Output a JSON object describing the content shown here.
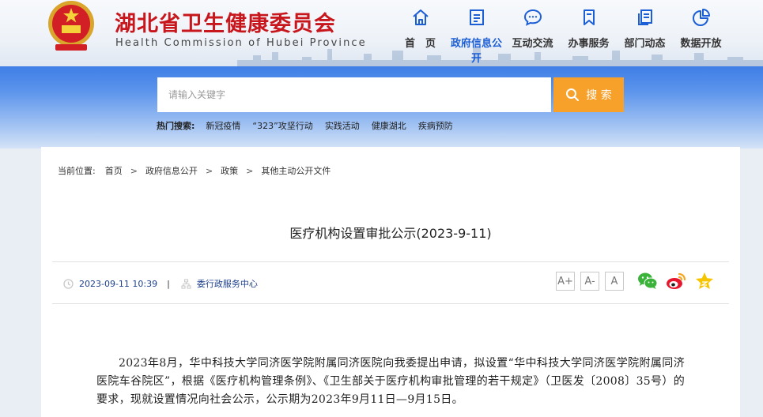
{
  "header": {
    "site_title": "湖北省卫生健康委员会",
    "site_subtitle": "Health Commission of Hubei Province",
    "nav": [
      {
        "label": "首　页",
        "icon": "home-icon"
      },
      {
        "label": "政府信息公开",
        "icon": "document-icon",
        "active": true
      },
      {
        "label": "互动交流",
        "icon": "chat-icon"
      },
      {
        "label": "办事服务",
        "icon": "bookmark-icon"
      },
      {
        "label": "部门动态",
        "icon": "copy-icon"
      },
      {
        "label": "数据开放",
        "icon": "pie-chart-icon"
      }
    ]
  },
  "search": {
    "placeholder": "请输入关键字",
    "button_label": "搜 索",
    "hot_label": "热门搜索:",
    "hot_items": [
      "新冠疫情",
      "“323”攻坚行动",
      "实践活动",
      "健康湖北",
      "疾病预防"
    ]
  },
  "breadcrumb": {
    "label": "当前位置:",
    "items": [
      "首页",
      "政府信息公开",
      "政策",
      "其他主动公开文件"
    ]
  },
  "article": {
    "title": "医疗机构设置审批公示(2023-9-11)",
    "date": "2023-09-11 10:39",
    "source": "委行政服务中心",
    "body": "2023年8月，华中科技大学同济医学院附属同济医院向我委提出申请，拟设置“华中科技大学同济医学院附属同济医院车谷院区”，根据《医疗机构管理条例》、《卫生部关于医疗机构审批管理的若干规定》（卫医发〔2008〕35号）的要求，现就设置情况向社会公示，公示期为2023年9月11日—9月15日。"
  },
  "tools": {
    "font_sizes": [
      "A+",
      "A-",
      "A"
    ],
    "share": [
      "wechat-icon",
      "weibo-icon",
      "favorite-icon"
    ]
  },
  "colors": {
    "brand_red": "#c8161d",
    "nav_active": "#1b5ed6",
    "search_button": "#f7a12b",
    "meta_link": "#1c3f8c"
  }
}
